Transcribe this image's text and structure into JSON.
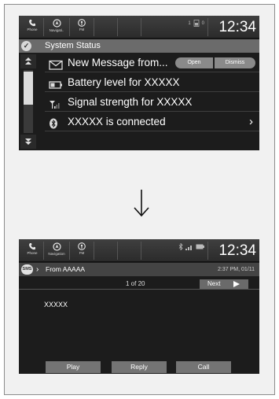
{
  "statusbar": {
    "phone_label": "Phone",
    "navigation_label": "Navigati..",
    "fm_label": "FM",
    "clock": "12:34",
    "indicator_top": "1",
    "indicator_bottom": "0"
  },
  "statusbar2": {
    "phone_label": "Phone",
    "navigation_label": "Navigation",
    "fm_label": "FM",
    "clock": "12:34"
  },
  "system_status": {
    "title": "System Status",
    "items": [
      {
        "icon": "envelope-icon",
        "text": "New Message from...",
        "open_label": "Open",
        "dismiss_label": "Dismiss"
      },
      {
        "icon": "battery-icon",
        "text": "Battery level for XXXXX"
      },
      {
        "icon": "signal-icon",
        "text": "Signal strength for XXXXX"
      },
      {
        "icon": "bluetooth-icon",
        "text": "XXXXX is connected"
      }
    ]
  },
  "message": {
    "sms_badge": "SMS",
    "from": "From AAAAA",
    "time": "2:37 PM, 01/11",
    "page": "1 of 20",
    "next_label": "Next",
    "body": "XXXXX",
    "actions": [
      "Play",
      "Reply",
      "Call"
    ]
  },
  "colors": {
    "screen_bg": "#1c1c1c",
    "header_bg": "#6b6b6b",
    "button_bg": "#747474"
  }
}
